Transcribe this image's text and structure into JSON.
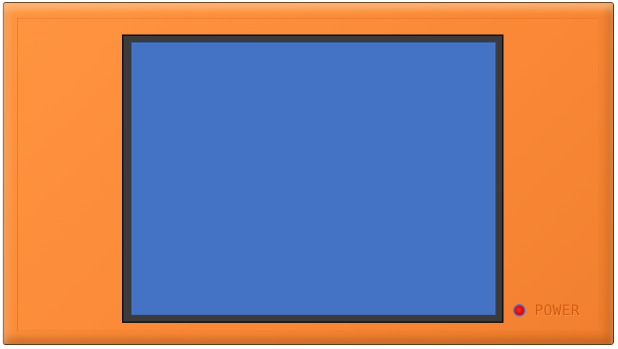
{
  "device": {
    "body_color": "#f98734",
    "screen": {
      "bezel_color": "#3b3b3b",
      "panel_color": "#4472c4"
    },
    "power": {
      "label": "POWER",
      "led_color": "#e00000",
      "led_state": "on"
    }
  }
}
